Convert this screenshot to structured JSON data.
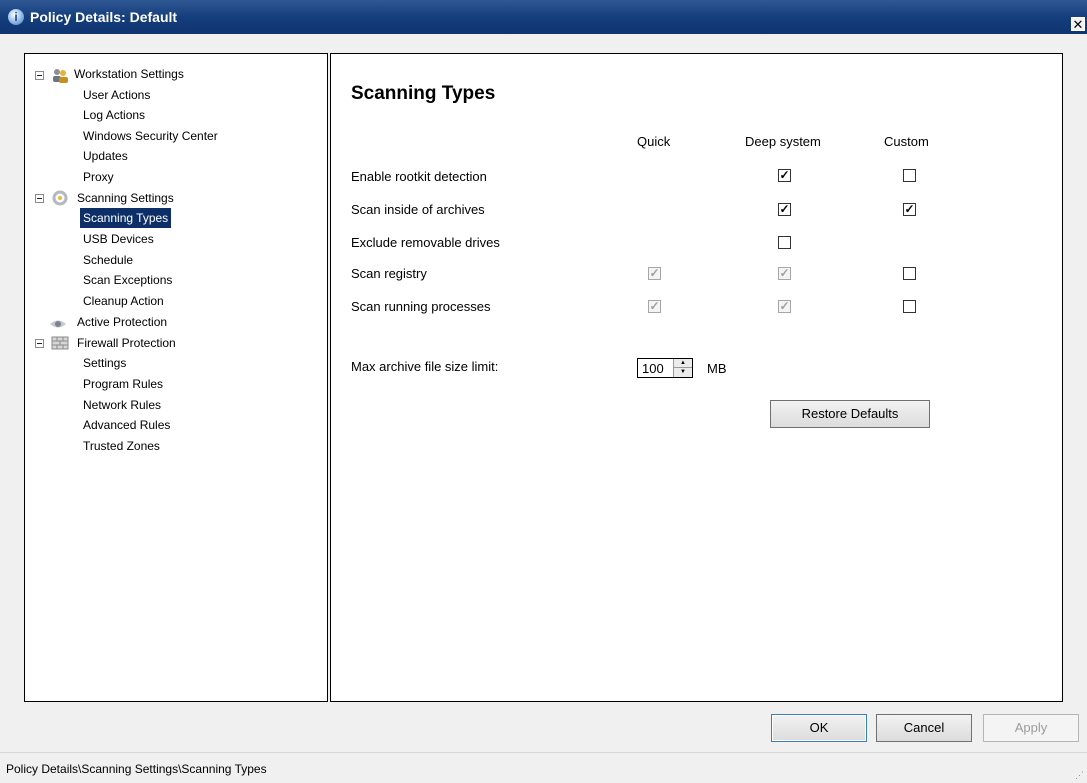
{
  "window": {
    "title": "Policy Details: Default",
    "title_icon": "i",
    "close_glyph": "✕"
  },
  "tree": {
    "workstation": {
      "label": "Workstation Settings",
      "children": [
        "User Actions",
        "Log Actions",
        "Windows Security Center",
        "Updates",
        "Proxy"
      ]
    },
    "scanning": {
      "label": "Scanning Settings",
      "children": [
        "Scanning Types",
        "USB Devices",
        "Schedule",
        "Scan Exceptions",
        "Cleanup Action"
      ],
      "selected": "Scanning Types"
    },
    "active_protection": {
      "label": "Active Protection"
    },
    "firewall": {
      "label": "Firewall Protection",
      "children": [
        "Settings",
        "Program Rules",
        "Network Rules",
        "Advanced Rules",
        "Trusted Zones"
      ]
    }
  },
  "content": {
    "heading": "Scanning Types",
    "columns": [
      "Quick",
      "Deep system",
      "Custom"
    ],
    "rows": [
      {
        "label": "Enable rootkit detection",
        "quick": "none",
        "deep": "checked",
        "custom": "unchecked"
      },
      {
        "label": "Scan inside of archives",
        "quick": "none",
        "deep": "checked",
        "custom": "checked"
      },
      {
        "label": "Exclude removable drives",
        "quick": "none",
        "deep": "unchecked",
        "custom": "none"
      },
      {
        "label": "Scan registry",
        "quick": "checked-disabled",
        "deep": "checked-disabled",
        "custom": "unchecked"
      },
      {
        "label": "Scan running processes",
        "quick": "checked-disabled",
        "deep": "checked-disabled",
        "custom": "unchecked"
      }
    ],
    "archive_limit": {
      "label": "Max archive file size limit:",
      "value": "100",
      "unit": "MB"
    },
    "restore_label": "Restore Defaults"
  },
  "buttons": {
    "ok": "OK",
    "cancel": "Cancel",
    "apply": "Apply"
  },
  "status": "Policy Details\\Scanning Settings\\Scanning Types",
  "icons": {
    "workstation": "workstation-users-icon",
    "scanning": "scanning-gears-icon",
    "active": "eye-shield-icon",
    "firewall": "brick-wall-icon"
  },
  "colors": {
    "titlebar": "#153e7d",
    "selection": "#0c2f68",
    "panel_border": "#000000"
  }
}
